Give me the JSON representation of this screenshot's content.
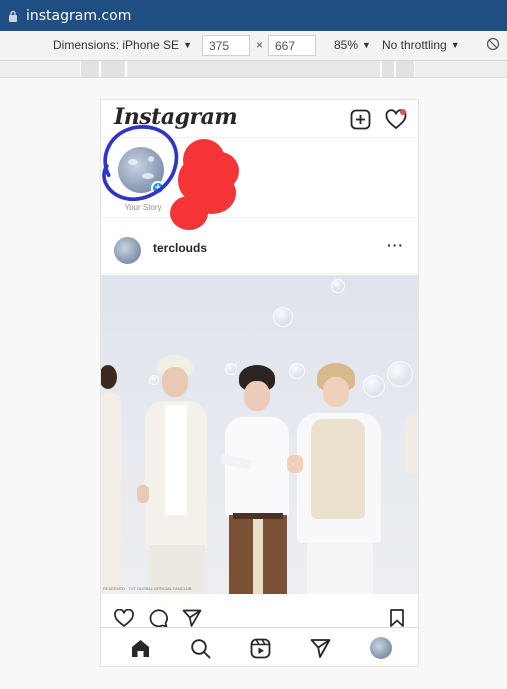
{
  "browser": {
    "url": "instagram.com"
  },
  "devtools": {
    "dimensions_label": "Dimensions: iPhone SE",
    "width_value": "375",
    "times": "×",
    "height_value": "667",
    "zoom": "85%",
    "throttling": "No throttling"
  },
  "instagram": {
    "logo": "Instagram",
    "story_label": "Your Story",
    "story_plus": "+",
    "post": {
      "username": "terclouds",
      "more": "···",
      "photo_caption": "RESERVED · TXT GLOBAL OFFICIAL FANCLUB"
    }
  },
  "icons": {
    "lock": "lock-icon",
    "new_post": "new-post-icon",
    "activity": "heart-icon",
    "like": "heart-icon",
    "comment": "comment-icon",
    "share": "paper-plane-icon",
    "save": "bookmark-icon",
    "home": "home-icon",
    "search": "search-icon",
    "reels": "reels-icon",
    "direct": "direct-icon",
    "rotate": "rotate-icon"
  },
  "colors": {
    "addr_bar": "#1f4e82",
    "story_plus": "#0095f6",
    "annotation_red": "#f53437",
    "annotation_blue": "#2f33c7",
    "notification_dot": "#ed4956"
  }
}
